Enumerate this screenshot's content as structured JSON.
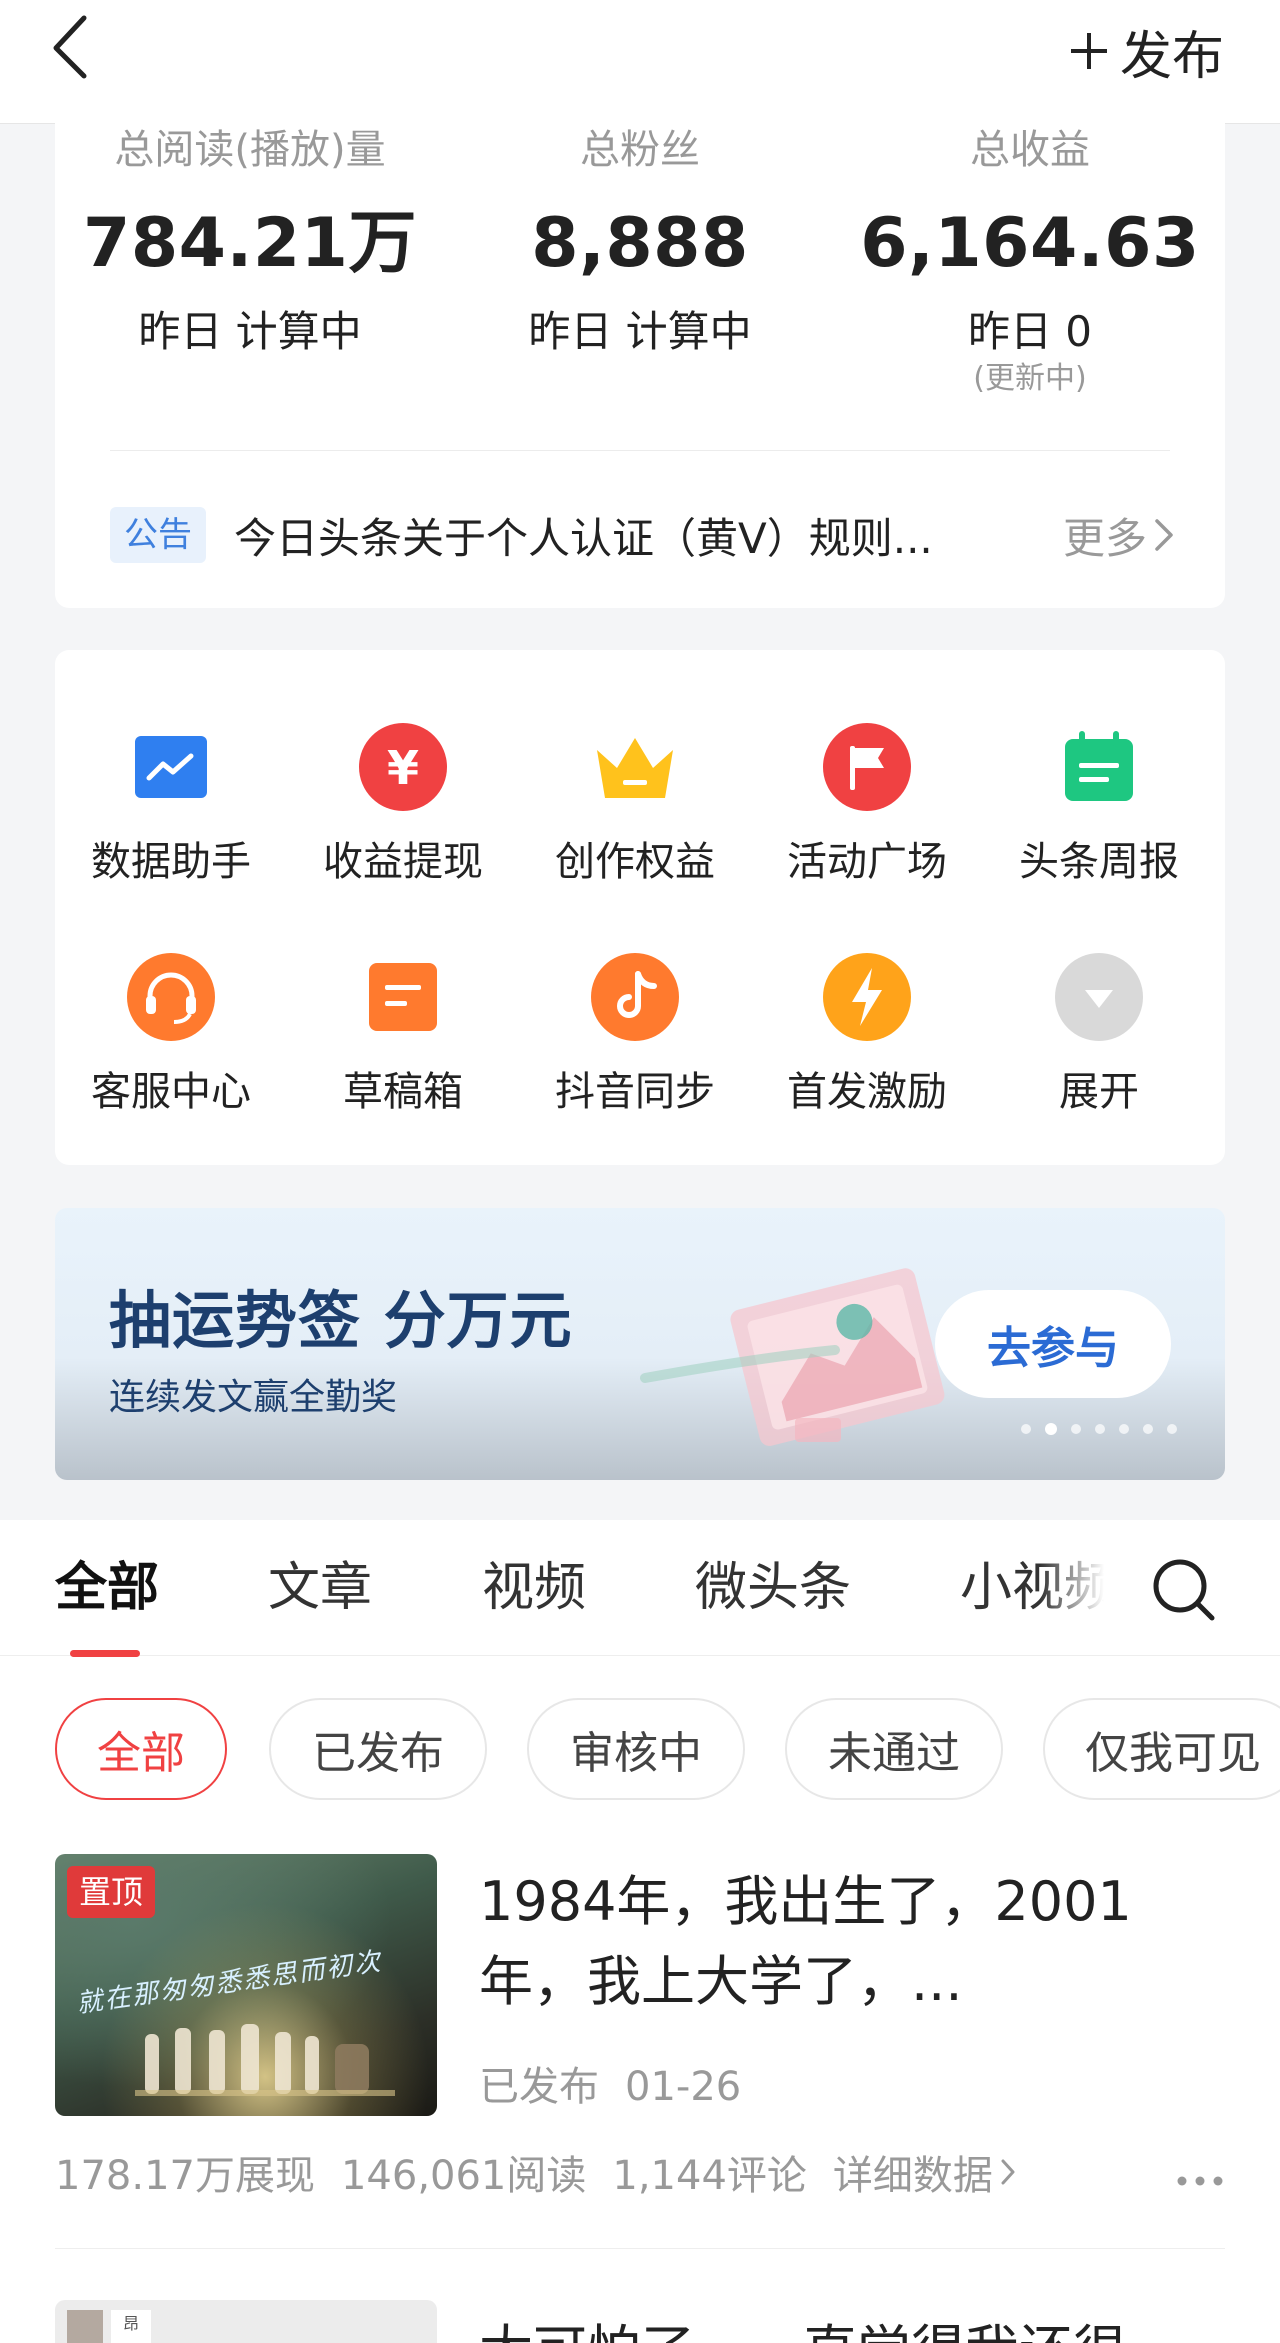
{
  "header": {
    "back_icon": "chevron-left-icon",
    "publish_label": "发布"
  },
  "stats": [
    {
      "label": "总阅读(播放)量",
      "value": "784.21万",
      "sub": "昨日 计算中"
    },
    {
      "label": "总粉丝",
      "value": "8,888",
      "sub": "昨日 计算中"
    },
    {
      "label": "总收益",
      "value": "6,164.63",
      "sub": "昨日 0",
      "sub2": "(更新中)"
    }
  ],
  "notice": {
    "badge": "公告",
    "text": "今日头条关于个人认证（黄V）规则...",
    "more": "更多"
  },
  "tools": [
    {
      "label": "数据助手",
      "icon": "chart-icon",
      "color": "#2f7ff0"
    },
    {
      "label": "收益提现",
      "icon": "yuan-icon",
      "color": "#f04142"
    },
    {
      "label": "创作权益",
      "icon": "crown-icon",
      "color": "#ffc21c"
    },
    {
      "label": "活动广场",
      "icon": "flag-icon",
      "color": "#f04142"
    },
    {
      "label": "头条周报",
      "icon": "calendar-icon",
      "color": "#1ec781"
    },
    {
      "label": "客服中心",
      "icon": "headset-icon",
      "color": "#ff7a2e"
    },
    {
      "label": "草稿箱",
      "icon": "draft-icon",
      "color": "#ff7a2e"
    },
    {
      "label": "抖音同步",
      "icon": "tiktok-icon",
      "color": "#ff7a2e"
    },
    {
      "label": "首发激励",
      "icon": "lightning-icon",
      "color": "#ffa31a"
    },
    {
      "label": "展开",
      "icon": "chevron-down-icon",
      "color": "#d9d9d9"
    }
  ],
  "banner": {
    "title": "抽运势签 分万元",
    "subtitle": "连续发文赢全勤奖",
    "button": "去参与",
    "active_slide": 2,
    "slides_total": 7
  },
  "tabs": [
    "全部",
    "文章",
    "视频",
    "微头条",
    "小视频"
  ],
  "active_tab": "全部",
  "filters": [
    "全部",
    "已发布",
    "审核中",
    "未通过",
    "仅我可见"
  ],
  "article": {
    "pin_label": "置顶",
    "thumb_text": "就在那匆匆悉悉思而初次",
    "title": "1984年，我出生了，2001年，我上大学了，...",
    "status": "已发布",
    "date": "01-26",
    "impressions": "178.17万展现",
    "reads": "146,061阅读",
    "comments": "1,144评论",
    "detail_label": "详细数据"
  },
  "article2": {
    "title": "太可怕了，一直觉得我还很",
    "mini_char": "昂"
  },
  "colors": {
    "accent": "#f04142",
    "link_blue": "#3f80de",
    "banner_navy": "#1d3f6e"
  }
}
